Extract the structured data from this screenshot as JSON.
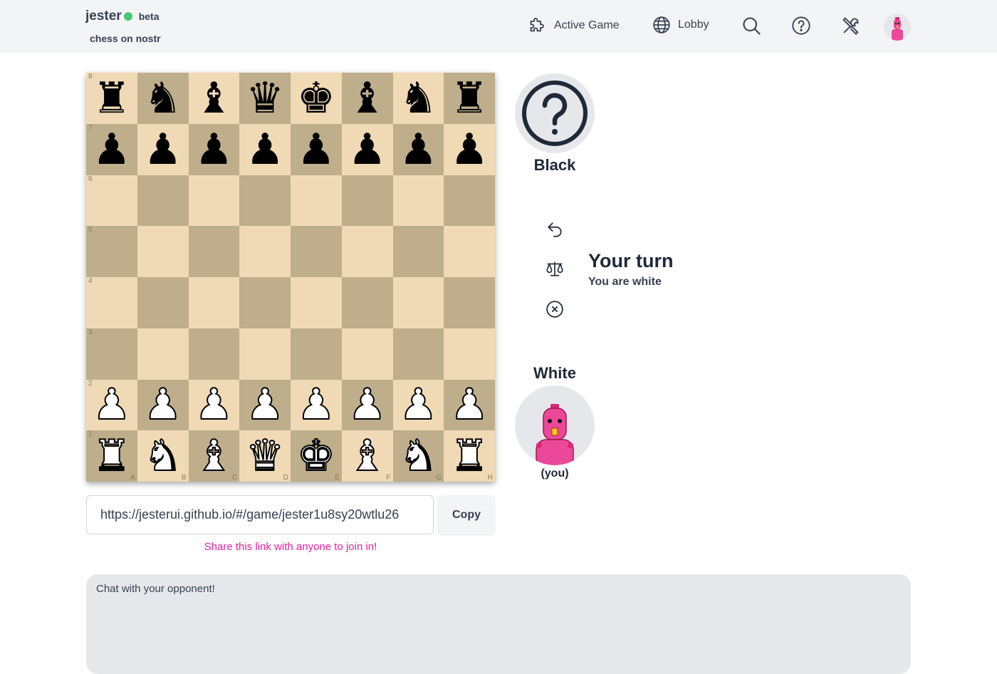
{
  "header": {
    "brand": "jester",
    "beta": "beta",
    "subtitle": "chess on nostr",
    "nav": {
      "active_game": "Active Game",
      "lobby": "Lobby"
    },
    "icons": [
      "puzzle-icon",
      "globe-icon",
      "search-icon",
      "help-icon",
      "tools-icon"
    ]
  },
  "board": {
    "ranks": [
      [
        "r",
        "n",
        "b",
        "q",
        "k",
        "b",
        "n",
        "r"
      ],
      [
        "p",
        "p",
        "p",
        "p",
        "p",
        "p",
        "p",
        "p"
      ],
      [
        "",
        "",
        "",
        "",
        "",
        "",
        "",
        ""
      ],
      [
        "",
        "",
        "",
        "",
        "",
        "",
        "",
        ""
      ],
      [
        "",
        "",
        "",
        "",
        "",
        "",
        "",
        ""
      ],
      [
        "",
        "",
        "",
        "",
        "",
        "",
        "",
        ""
      ],
      [
        "P",
        "P",
        "P",
        "P",
        "P",
        "P",
        "P",
        "P"
      ],
      [
        "R",
        "N",
        "B",
        "Q",
        "K",
        "B",
        "N",
        "R"
      ]
    ],
    "rank_labels": [
      "8",
      "7",
      "6",
      "5",
      "4",
      "3",
      "2",
      "1"
    ],
    "file_labels": [
      "A",
      "B",
      "C",
      "D",
      "E",
      "F",
      "G",
      "H"
    ],
    "colors": {
      "light": "#f0d9b5",
      "dark": "#beae8b"
    }
  },
  "share": {
    "url": "https://jesterui.github.io/#/game/jester1u8sy20wtlu26",
    "copy_label": "Copy",
    "hint": "Share this link with anyone to join in!"
  },
  "players": {
    "black": {
      "name": "Black"
    },
    "white": {
      "name": "White",
      "you": "(you)"
    }
  },
  "status": {
    "title": "Your turn",
    "subtitle": "You are white"
  },
  "actions": [
    "undo-icon",
    "balance-icon",
    "resign-icon"
  ],
  "chat": {
    "placeholder": "Chat with your opponent!"
  },
  "accent": {
    "pink": "#e91e9d",
    "online": "#48c774"
  }
}
